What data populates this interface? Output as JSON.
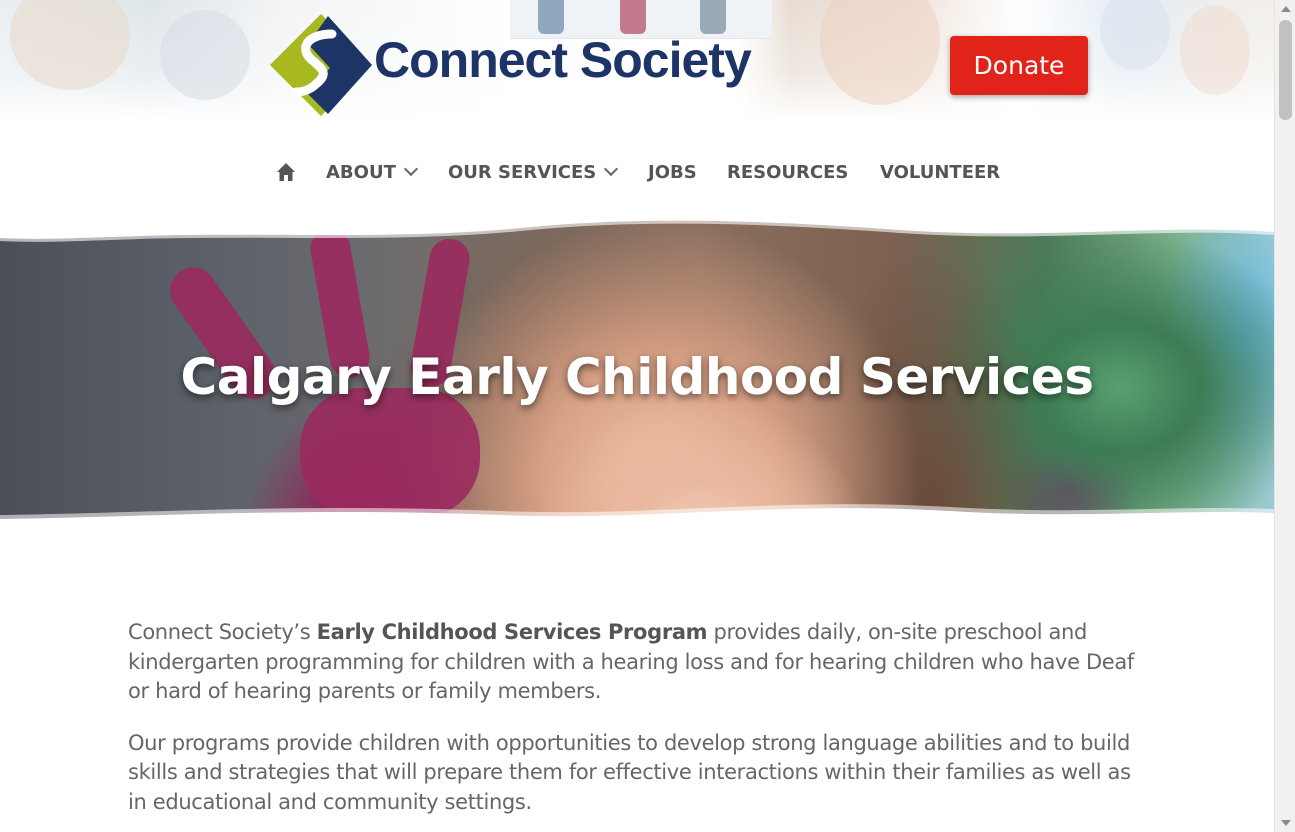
{
  "header": {
    "logo_text": "Connect Society",
    "donate_label": "Donate"
  },
  "nav": {
    "home_icon": "home-icon",
    "items": [
      {
        "label": "ABOUT",
        "has_dropdown": true
      },
      {
        "label": "OUR SERVICES",
        "has_dropdown": true
      },
      {
        "label": "JOBS",
        "has_dropdown": false
      },
      {
        "label": "RESOURCES",
        "has_dropdown": false
      },
      {
        "label": "VOLUNTEER",
        "has_dropdown": false
      }
    ]
  },
  "hero": {
    "title": "Calgary Early Childhood Services"
  },
  "content": {
    "p1_before": "Connect Society’s ",
    "p1_bold": "Early Childhood Services Program",
    "p1_after": " provides daily, on-site preschool and kindergarten programming for children with a hearing loss and for hearing children who have Deaf or hard of hearing parents or family members.",
    "p2": "Our programs provide children with opportunities to develop strong language abilities and to build skills and strategies that will prepare them for effective interactions within their families as well as in educational and community settings."
  },
  "colors": {
    "donate_bg": "#e2231a",
    "logo_navy": "#1d3466",
    "logo_lime": "#a8b820",
    "nav_text": "#555555",
    "body_text": "#666666"
  }
}
